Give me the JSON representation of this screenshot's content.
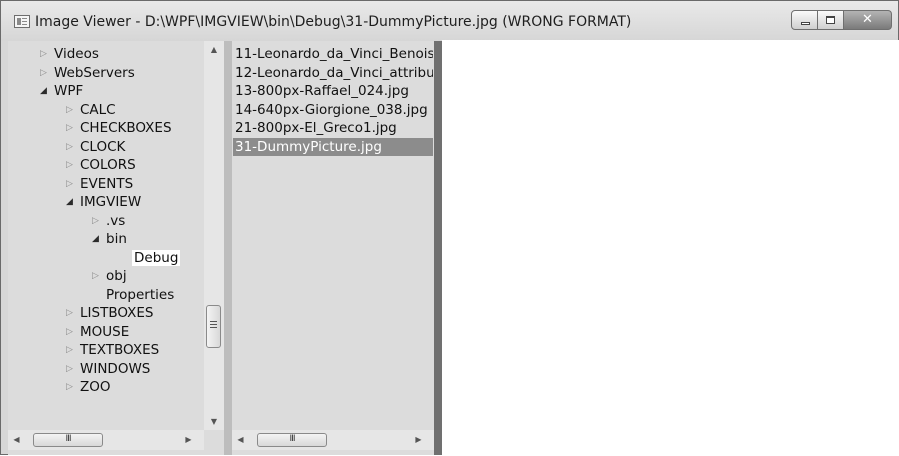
{
  "window": {
    "title": "Image Viewer - D:\\WPF\\IMGVIEW\\bin\\Debug\\31-DummyPicture.jpg (WRONG FORMAT)",
    "app_icon": "image-viewer-icon",
    "caption_buttons": {
      "minimize_icon": "minimize-icon",
      "maximize_icon": "maximize-icon",
      "close_label": "✕"
    }
  },
  "tree": {
    "items": [
      {
        "label": "Videos",
        "expander": "▷"
      },
      {
        "label": "WebServers",
        "expander": "▷"
      },
      {
        "label": "WPF",
        "expander": "◢"
      },
      {
        "label": "CALC",
        "expander": "▷"
      },
      {
        "label": "CHECKBOXES",
        "expander": "▷"
      },
      {
        "label": "CLOCK",
        "expander": "▷"
      },
      {
        "label": "COLORS",
        "expander": "▷"
      },
      {
        "label": "EVENTS",
        "expander": "▷"
      },
      {
        "label": "IMGVIEW",
        "expander": "◢"
      },
      {
        "label": ".vs",
        "expander": "▷"
      },
      {
        "label": "bin",
        "expander": "◢"
      },
      {
        "label": "Debug",
        "expander": ""
      },
      {
        "label": "obj",
        "expander": "▷"
      },
      {
        "label": "Properties",
        "expander": ""
      },
      {
        "label": "LISTBOXES",
        "expander": "▷"
      },
      {
        "label": "MOUSE",
        "expander": "▷"
      },
      {
        "label": "TEXTBOXES",
        "expander": "▷"
      },
      {
        "label": "WINDOWS",
        "expander": "▷"
      },
      {
        "label": "ZOO",
        "expander": "▷"
      }
    ],
    "selected": "Debug",
    "vscroll": {
      "up_arrow": "▲",
      "down_arrow": "▼"
    },
    "hscroll": {
      "left_arrow": "◀",
      "right_arrow": "▶",
      "thumb_grip": "III"
    }
  },
  "file_list": {
    "items": [
      "11-Leonardo_da_Vinci_Benois",
      "12-Leonardo_da_Vinci_attribu",
      "13-800px-Raffael_024.jpg",
      "14-640px-Giorgione_038.jpg",
      "21-800px-El_Greco1.jpg",
      "31-DummyPicture.jpg"
    ],
    "selected": "31-DummyPicture.jpg",
    "hscroll": {
      "left_arrow": "◀",
      "right_arrow": "▶",
      "thumb_grip": "III"
    }
  },
  "colors": {
    "selection_list": "#8c8c8c",
    "selection_tree": "#ffffff",
    "pane_background": "#dcdcdc",
    "image_area": "#ffffff"
  }
}
